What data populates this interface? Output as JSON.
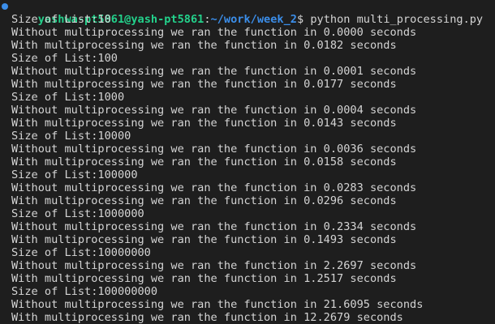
{
  "terminal": {
    "prompt": {
      "user_host": "yashwa-pt5861@yash-pt5861",
      "colon": ":",
      "path": "~/work/week_2",
      "dollar": "$ ",
      "command": "python multi_processing.py"
    },
    "output": [
      "Size of List:10",
      "Without multiprocessing we ran the function in 0.0000 seconds",
      "With multiprocessing we ran the function in 0.0182 seconds",
      "Size of List:100",
      "Without multiprocessing we ran the function in 0.0001 seconds",
      "With multiprocessing we ran the function in 0.0177 seconds",
      "Size of List:1000",
      "Without multiprocessing we ran the function in 0.0004 seconds",
      "With multiprocessing we ran the function in 0.0143 seconds",
      "Size of List:10000",
      "Without multiprocessing we ran the function in 0.0036 seconds",
      "With multiprocessing we ran the function in 0.0158 seconds",
      "Size of List:100000",
      "Without multiprocessing we ran the function in 0.0283 seconds",
      "With multiprocessing we ran the function in 0.0296 seconds",
      "Size of List:1000000",
      "Without multiprocessing we ran the function in 0.2334 seconds",
      "With multiprocessing we ran the function in 0.1493 seconds",
      "Size of List:10000000",
      "Without multiprocessing we ran the function in 2.2697 seconds",
      "With multiprocessing we ran the function in 1.2517 seconds",
      "Size of List:100000000",
      "Without multiprocessing we ran the function in 21.6095 seconds",
      "With multiprocessing we ran the function in 12.2679 seconds"
    ]
  }
}
